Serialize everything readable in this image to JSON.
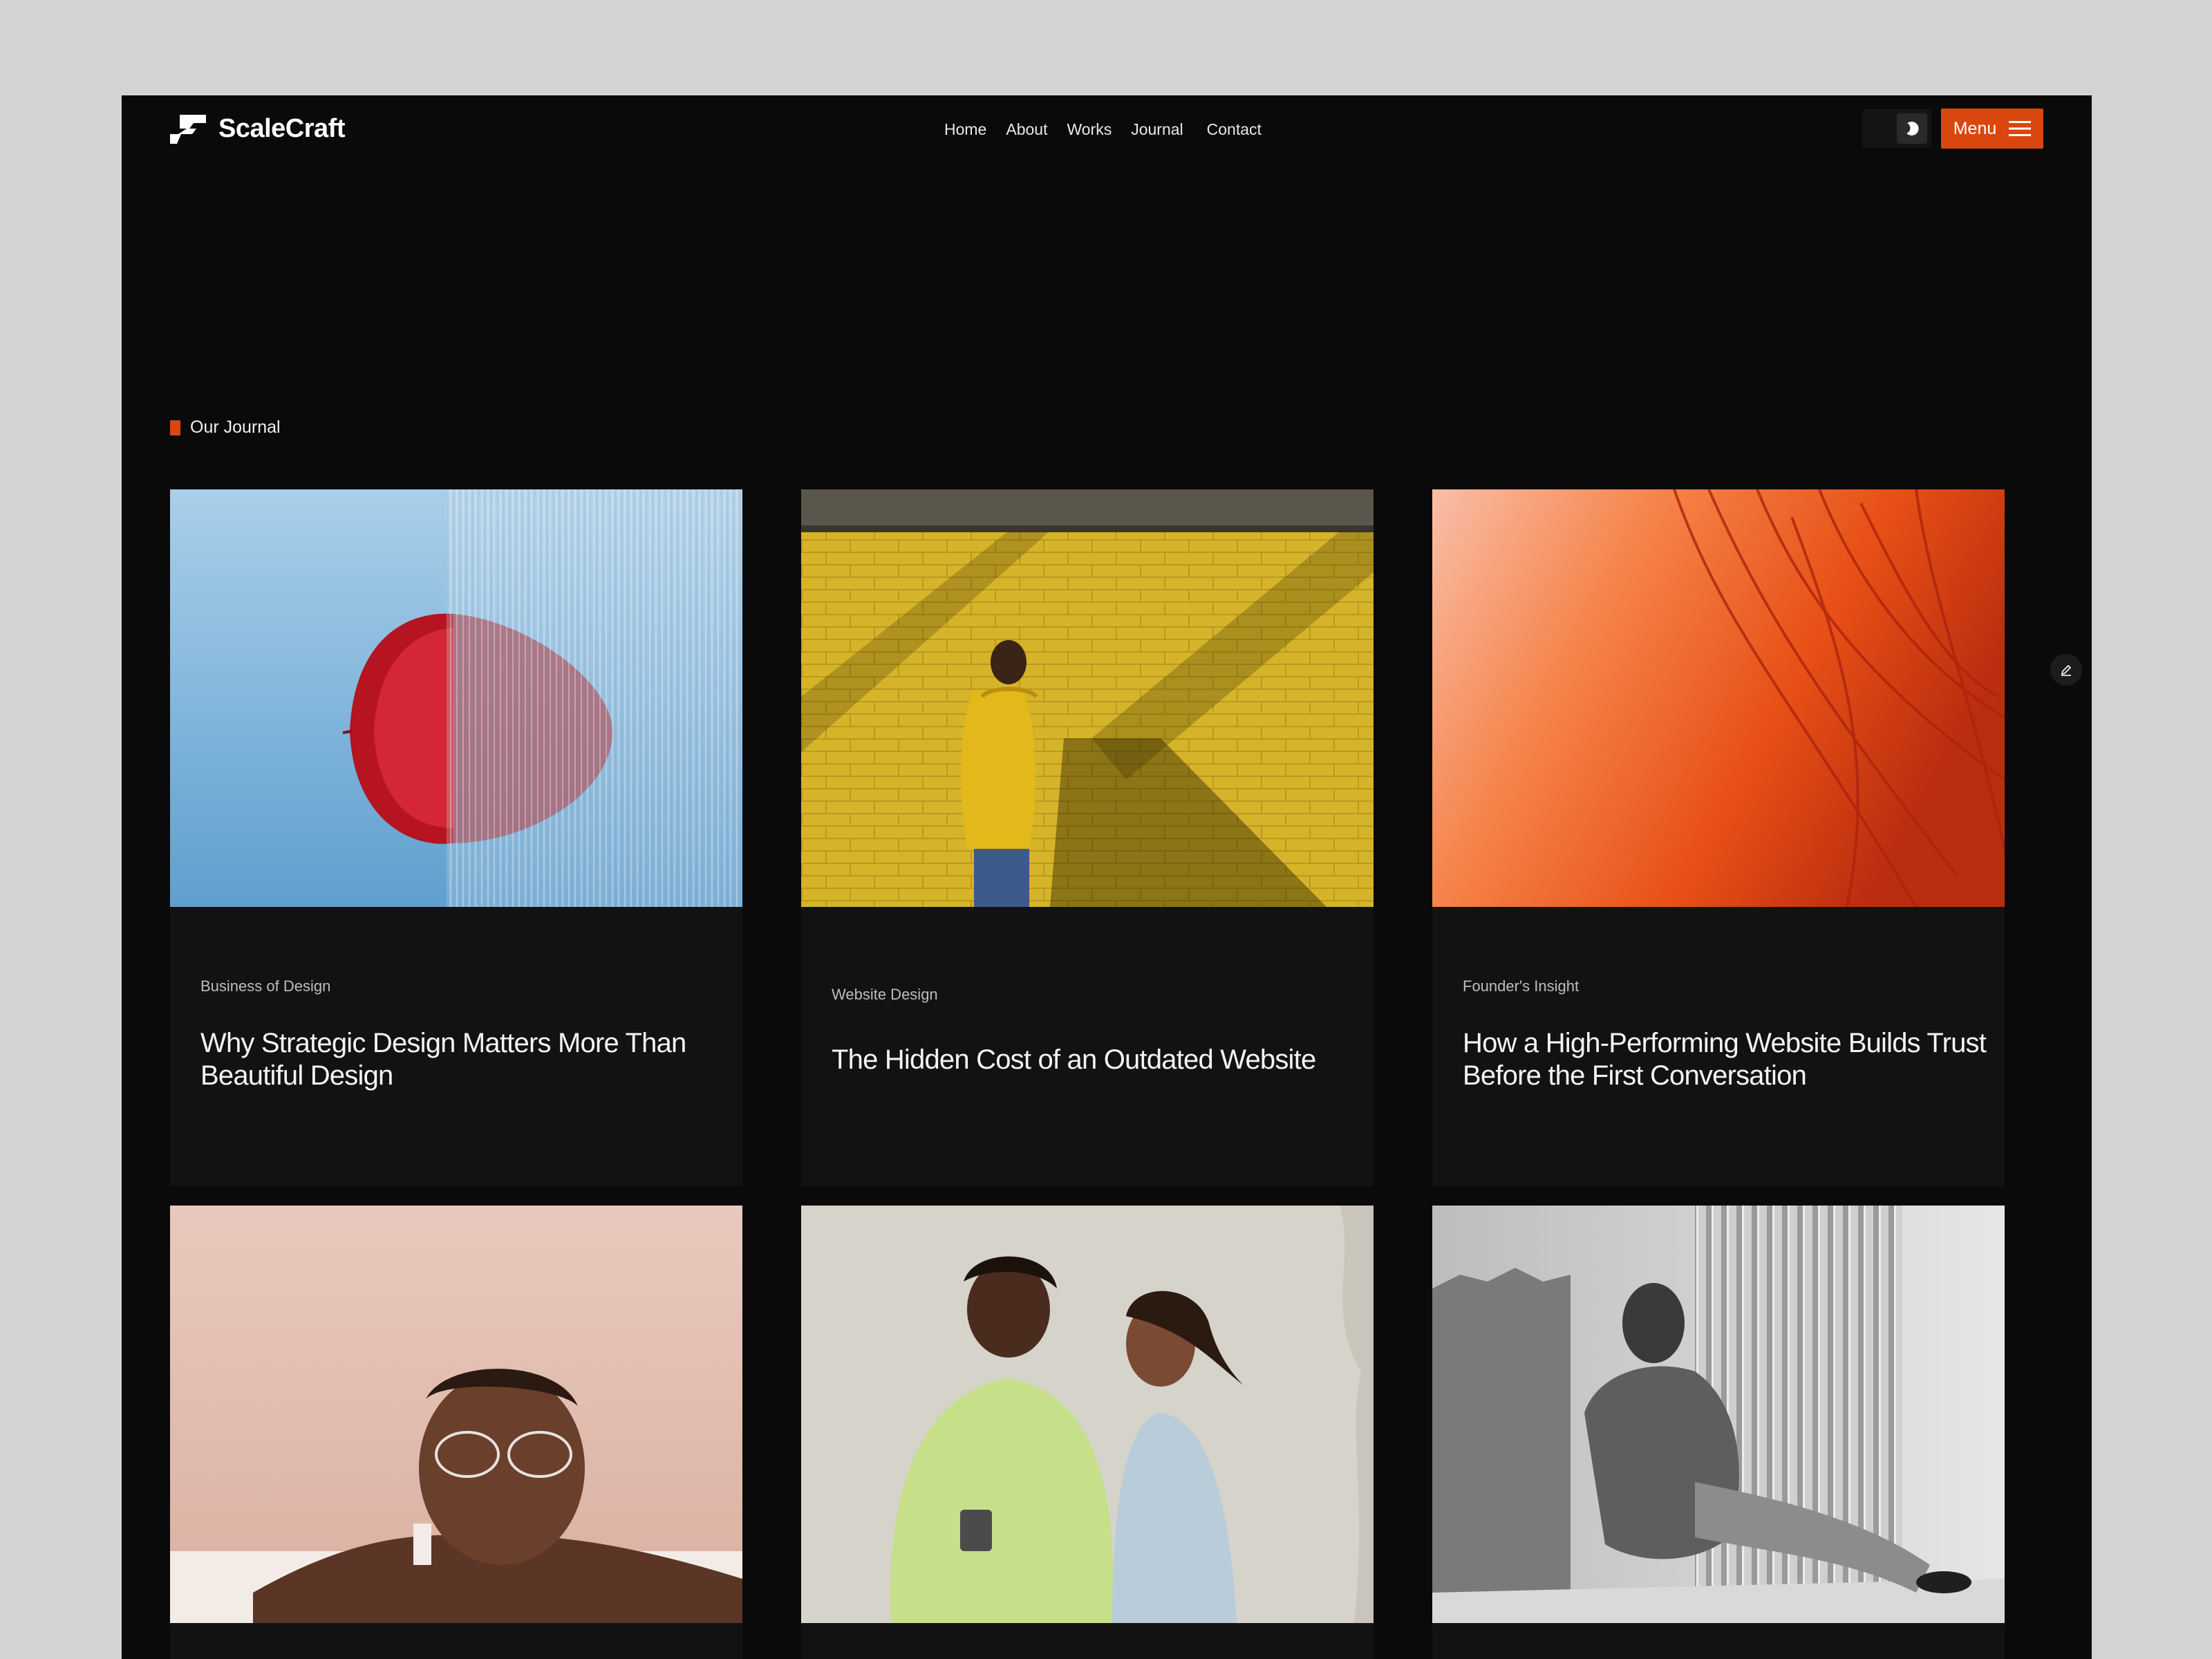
{
  "header": {
    "brand": "ScaleCraft",
    "nav": [
      {
        "label": "Home"
      },
      {
        "label": "About"
      },
      {
        "label": "Works"
      },
      {
        "label": "Journal"
      },
      {
        "label": "Contact"
      }
    ],
    "menu_label": "Menu",
    "theme_icon": "moon-icon"
  },
  "section": {
    "label": "Our Journal"
  },
  "posts": [
    {
      "category": "Business of Design",
      "title": "Why Strategic Design Matters More Than Beautiful Design",
      "image": "red-leaf-behind-glass"
    },
    {
      "category": "Website Design",
      "title": "The Hidden Cost of an Outdated Website",
      "image": "man-yellow-hoodie-brick-wall"
    },
    {
      "category": "Founder's Insight",
      "title": "How a High-Performing Website Builds Trust Before the First Conversation",
      "image": "orange-abstract-fibers"
    },
    {
      "category": "",
      "title": "",
      "image": "woman-with-glasses-pink"
    },
    {
      "category": "",
      "title": "",
      "image": "two-women-laughing"
    },
    {
      "category": "",
      "title": "",
      "image": "man-seated-monochrome"
    }
  ],
  "colors": {
    "accent": "#d9470f",
    "page_background": "#0a0a0a",
    "card_background": "#121212",
    "outer_background": "#d4d3d4"
  }
}
